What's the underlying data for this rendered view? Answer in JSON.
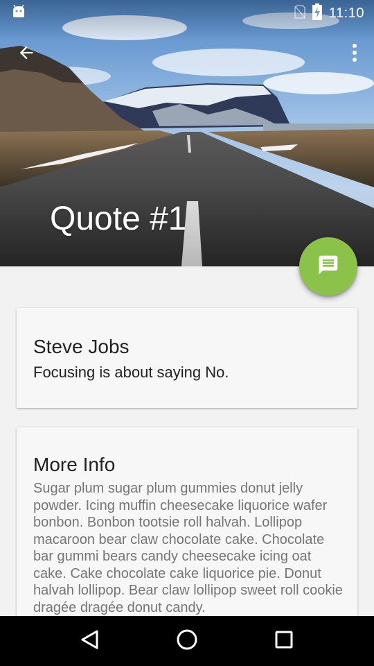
{
  "status_bar": {
    "time": "11:10",
    "icons": [
      "android-debug-icon",
      "no-sim-icon",
      "battery-charging-icon"
    ]
  },
  "toolbar": {
    "back_icon": "arrow-back-icon",
    "overflow_icon": "more-vert-icon"
  },
  "header": {
    "title": "Quote #1",
    "image": "mountain-road-landscape"
  },
  "fab": {
    "icon": "message-icon",
    "color": "#8bc34a"
  },
  "quote_card": {
    "author": "Steve Jobs",
    "quote": "Focusing is about saying No."
  },
  "info_card": {
    "title": "More Info",
    "body": "Sugar plum sugar plum gummies donut jelly powder. Icing muffin cheesecake liquorice wafer bonbon. Bonbon tootsie roll halvah. Lollipop macaroon bear claw chocolate cake. Chocolate bar gummi bears candy cheesecake icing oat cake. Cake chocolate cake liquorice pie. Donut halvah lollipop. Bear claw lollipop sweet roll cookie dragée dragée donut candy."
  },
  "nav_bar": {
    "buttons": [
      "back-triangle-icon",
      "home-circle-icon",
      "recents-square-icon"
    ]
  }
}
